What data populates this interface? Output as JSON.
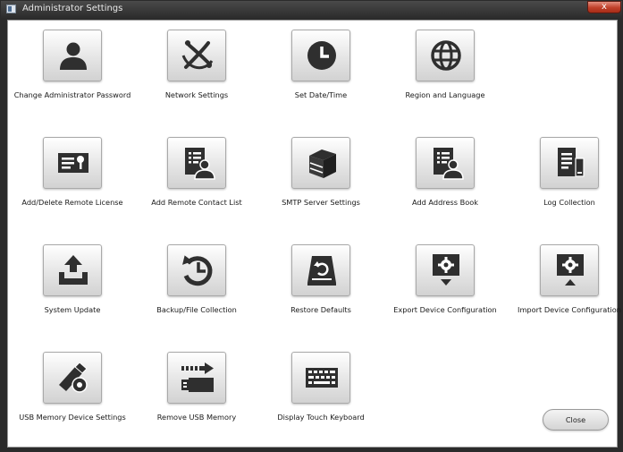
{
  "window": {
    "title": "Administrator Settings",
    "close_glyph": "x"
  },
  "tiles": [
    {
      "label": "Change Administrator Password",
      "icon": "user-icon"
    },
    {
      "label": "Network Settings",
      "icon": "network-icon"
    },
    {
      "label": "Set Date/Time",
      "icon": "clock-icon"
    },
    {
      "label": "Region and Language",
      "icon": "globe-icon"
    },
    {
      "label": "Add/Delete Remote License",
      "icon": "license-key-icon"
    },
    {
      "label": "Add Remote Contact List",
      "icon": "contact-list-icon"
    },
    {
      "label": "SMTP Server Settings",
      "icon": "server-icon"
    },
    {
      "label": "Add Address Book",
      "icon": "address-book-icon"
    },
    {
      "label": "Log Collection",
      "icon": "log-collection-icon"
    },
    {
      "label": "System Update",
      "icon": "system-update-icon"
    },
    {
      "label": "Backup/File Collection",
      "icon": "backup-icon"
    },
    {
      "label": "Restore Defaults",
      "icon": "restore-icon"
    },
    {
      "label": "Export Device Configuration",
      "icon": "export-config-icon"
    },
    {
      "label": "Import Device Configuration",
      "icon": "import-config-icon"
    },
    {
      "label": "USB Memory Device Settings",
      "icon": "usb-settings-icon"
    },
    {
      "label": "Remove USB Memory",
      "icon": "remove-usb-icon"
    },
    {
      "label": "Display Touch Keyboard",
      "icon": "keyboard-icon"
    }
  ],
  "footer": {
    "close_label": "Close"
  },
  "colors": {
    "icon_dark": "#2f2f2f",
    "titlebar": "#2c2c2c",
    "close_red": "#c0402a"
  }
}
